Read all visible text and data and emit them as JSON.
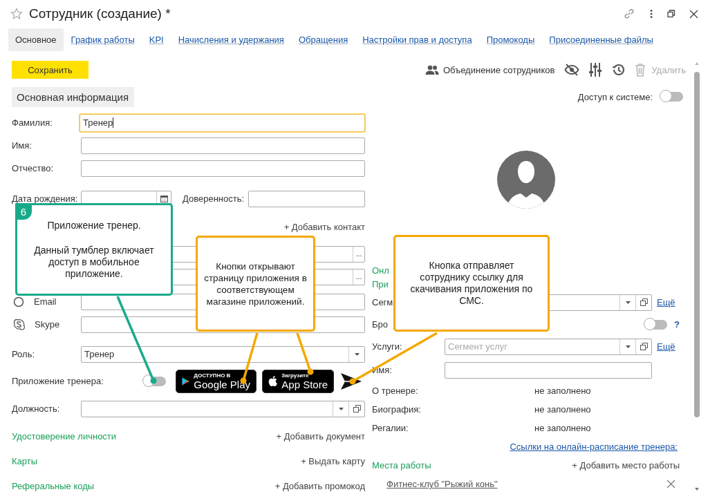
{
  "window": {
    "title": "Сотрудник (создание) *"
  },
  "tabs": [
    {
      "label": "Основное",
      "selected": true
    },
    {
      "label": "График работы",
      "selected": false
    },
    {
      "label": "KPI",
      "selected": false
    },
    {
      "label": "Начисления и удержания",
      "selected": false
    },
    {
      "label": "Обращения",
      "selected": false
    },
    {
      "label": "Настройки прав и доступа",
      "selected": false
    },
    {
      "label": "Промокоды",
      "selected": false
    },
    {
      "label": "Присоединенные файлы",
      "selected": false
    }
  ],
  "toolbar": {
    "save": "Сохранить",
    "merge": "Объединение сотрудников",
    "delete": {
      "label": "Удалить",
      "disabled": true
    }
  },
  "section": {
    "title": "Основная информация"
  },
  "system_access": {
    "label": "Доступ к системе:",
    "on": false
  },
  "person_fields": [
    {
      "label": "Фамилия:",
      "value": "Тренер",
      "focused": true
    },
    {
      "label": "Имя:",
      "focused": false
    },
    {
      "label": "Отчество:",
      "focused": false
    }
  ],
  "birth_date": {
    "label": "Дата рождения:"
  },
  "proxy": {
    "label": "Доверенность:"
  },
  "contacts": {
    "add": "+ Добавить контакт",
    "rows": [
      {
        "kind": "plain",
        "action": "..."
      },
      {
        "kind": "plain",
        "action": "..."
      },
      {
        "kind": "email",
        "label": "Email"
      },
      {
        "kind": "skype",
        "label": "Skype"
      }
    ]
  },
  "role": {
    "label": "Роль:",
    "value": "Тренер"
  },
  "trainer_app": {
    "label": "Приложение тренера:",
    "on": false,
    "stores": [
      {
        "kind": "google",
        "caption": "ДОСТУПНО В",
        "name": "Google Play"
      },
      {
        "kind": "apple",
        "caption": "Загрузите",
        "name": "App Store"
      }
    ]
  },
  "position": {
    "label": "Должность:"
  },
  "sections": [
    {
      "title": "Удостоверение личности",
      "action": "+ Добавить документ"
    },
    {
      "title": "Карты",
      "action": "+ Выдать карту"
    },
    {
      "title": "Реферальные коды",
      "action": "+ Добавить промокод"
    }
  ],
  "right_groups": [
    "Онл",
    "При"
  ],
  "right_fields": [
    {
      "kind": "combo",
      "label": "Сегм",
      "more": "Ещё"
    },
    {
      "kind": "toggle",
      "label": "Бро",
      "on": false,
      "help": "?"
    },
    {
      "kind": "combo",
      "label": "Услуги:",
      "placeholder": "Сегмент услуг",
      "more": "Ещё"
    },
    {
      "kind": "text",
      "label": "Имя:"
    }
  ],
  "info": [
    {
      "label": "О тренере:",
      "value": "не заполнено"
    },
    {
      "label": "Биография:",
      "value": "не заполнено"
    },
    {
      "label": "Регалии:",
      "value": "не заполнено"
    }
  ],
  "schedule_link": "Ссылки на онлайн-расписание тренера:",
  "workplaces": {
    "title": "Места работы",
    "action": "+ Добавить место работы",
    "items": [
      {
        "name": "Фитнес-клуб \"Рыжий конь\""
      }
    ]
  },
  "callouts": [
    {
      "color": "#1aaa8a",
      "number": "6",
      "paragraphs": [
        "Приложение тренер.",
        "Данный тумблер включает доступ в мобильное приложение."
      ]
    },
    {
      "color": "#f5a800",
      "paragraphs": [
        "Кнопки открывают страницу приложения в соответствующем магазине приложений."
      ]
    },
    {
      "color": "#f5a800",
      "paragraphs": [
        "Кнопка отправляет сотруднику ссылку для скачивания приложения по СМС."
      ]
    }
  ]
}
